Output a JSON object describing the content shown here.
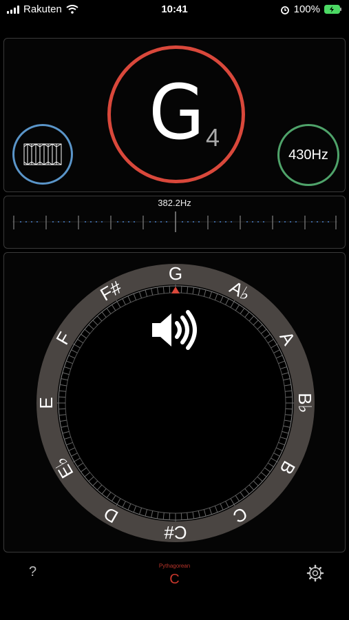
{
  "status": {
    "carrier": "Rakuten",
    "time": "10:41",
    "battery": "100%"
  },
  "tuner": {
    "note": "G",
    "octave": "4",
    "reference_hz": "430Hz",
    "frequency": "382.2Hz"
  },
  "wheel": {
    "notes": [
      "G",
      "A♭",
      "A",
      "B♭",
      "B",
      "C",
      "C#",
      "D",
      "E♭",
      "E",
      "F",
      "F#"
    ]
  },
  "bottom": {
    "help": "?",
    "temperament": "Pythagorean",
    "key": "C"
  },
  "colors": {
    "note_ring": "#d9483b",
    "wave_ring": "#5a95c9",
    "hz_ring": "#4fa36a",
    "accent_red": "#c9372c",
    "wheel_band": "#4a4542"
  }
}
